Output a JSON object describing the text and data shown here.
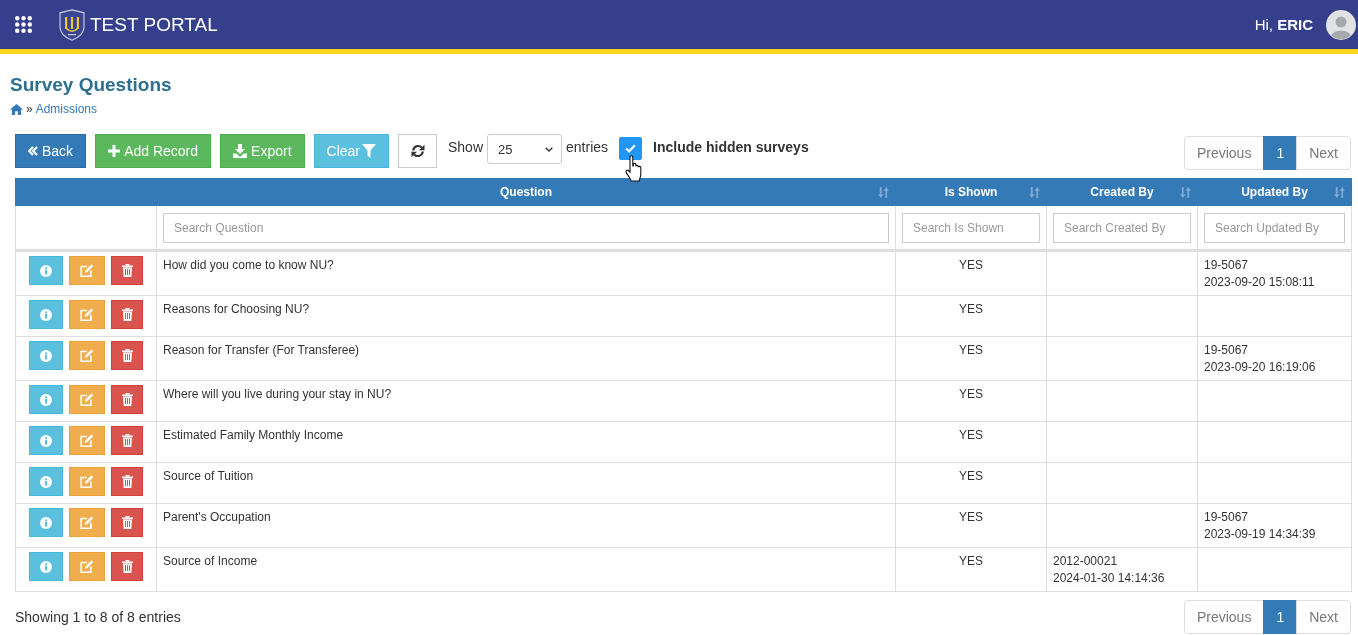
{
  "header": {
    "title": "TEST PORTAL",
    "greeting": "Hi, **ERIC**"
  },
  "page": {
    "title": "Survey Questions",
    "breadcrumb": {
      "separator": "»",
      "link": "Admissions"
    }
  },
  "toolbar": {
    "buttons": [
      {
        "kind": "back",
        "label": "Back"
      },
      {
        "kind": "add",
        "label": "Add Record"
      },
      {
        "kind": "export",
        "label": "Export"
      },
      {
        "kind": "clear",
        "label": "Clear"
      },
      {
        "kind": "refresh"
      }
    ],
    "length": {
      "prefix": "Show",
      "value": "25",
      "suffix": "entries"
    },
    "include_hidden": {
      "label": "Include hidden surveys",
      "checked": true
    }
  },
  "pagination_top": [
    {
      "label": "Previous",
      "selected": false,
      "disabled": true
    },
    {
      "label": "1",
      "selected": true,
      "disabled": false
    },
    {
      "label": "Next",
      "selected": false,
      "disabled": true
    }
  ],
  "table": {
    "columns": [
      {
        "label": "Question",
        "placeholder": "Search Question"
      },
      {
        "label": "Is Shown",
        "placeholder": "Search Is Shown"
      },
      {
        "label": "Created By",
        "placeholder": "Search Created By"
      },
      {
        "label": "Updated By",
        "placeholder": "Search Updated By"
      }
    ],
    "rows": [
      {
        "question": "How did you come to know NU?",
        "is_shown": "YES",
        "updated_by": {
          "user": "19-5067",
          "time": "2023-09-20 15:08:11"
        }
      },
      {
        "question": "Reasons for Choosing NU?",
        "is_shown": "YES"
      },
      {
        "question": "Reason for Transfer (For Transferee)",
        "is_shown": "YES",
        "updated_by": {
          "user": "19-5067",
          "time": "2023-09-20 16:19:06"
        }
      },
      {
        "question": "Where will you live during your stay in NU?",
        "is_shown": "YES"
      },
      {
        "question": "Estimated Family Monthly Income",
        "is_shown": "YES"
      },
      {
        "question": "Source of Tuition",
        "is_shown": "YES"
      },
      {
        "question": "Parent's Occupation",
        "is_shown": "YES",
        "updated_by": {
          "user": "19-5067",
          "time": "2023-09-19 14:34:39"
        }
      },
      {
        "question": "Source of Income",
        "is_shown": "YES",
        "created_by": {
          "user": "2012-00021",
          "time": "2024-01-30 14:14:36"
        }
      }
    ]
  },
  "footer": {
    "info": "Showing 1 to 8 of 8 entries",
    "pagination": [
      {
        "label": "Previous",
        "selected": false,
        "disabled": true
      },
      {
        "label": "1",
        "selected": true,
        "disabled": false
      },
      {
        "label": "Next",
        "selected": false,
        "disabled": true
      }
    ]
  }
}
